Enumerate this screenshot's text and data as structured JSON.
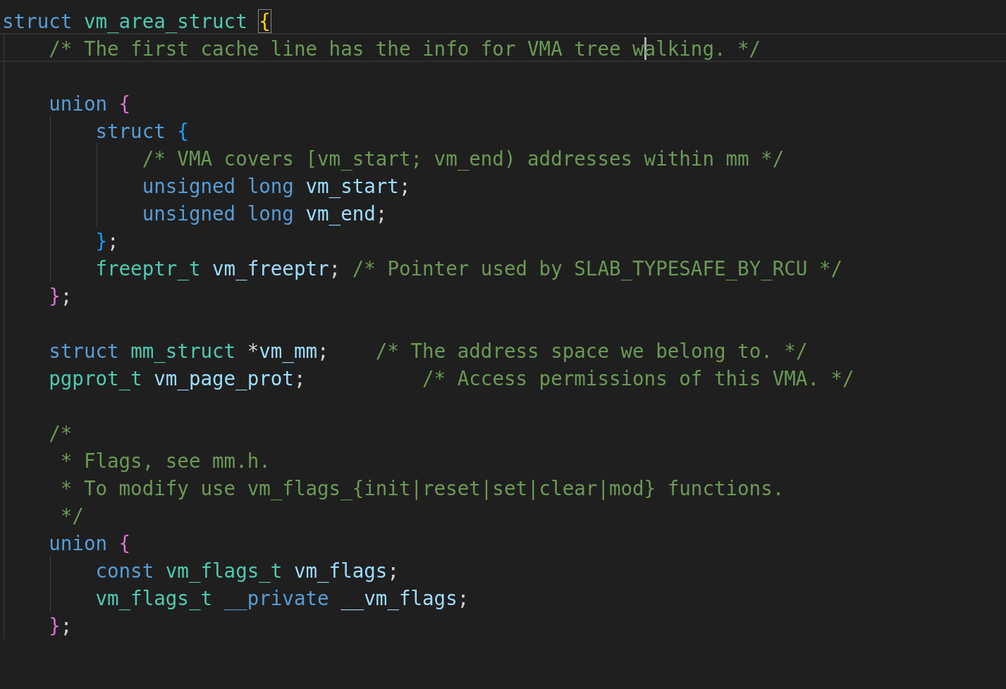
{
  "lines": [
    {
      "kind": "code",
      "tokens": [
        {
          "text": "struct ",
          "kind": "keyword"
        },
        {
          "text": "vm_area_struct ",
          "kind": "type"
        },
        {
          "text": "{",
          "kind": "brace1",
          "matched": true
        }
      ]
    },
    {
      "kind": "code",
      "current": true,
      "tokens": [
        {
          "text": "    /* The first cache line has the info for VMA tree w",
          "kind": "comment"
        },
        {
          "text": "alking. */",
          "kind": "comment",
          "cursor": true
        }
      ]
    },
    {
      "kind": "blank"
    },
    {
      "kind": "code",
      "tokens": [
        {
          "text": "    union ",
          "kind": "keyword"
        },
        {
          "text": "{",
          "kind": "brace2"
        }
      ]
    },
    {
      "kind": "code",
      "tokens": [
        {
          "text": "        struct ",
          "kind": "keyword"
        },
        {
          "text": "{",
          "kind": "brace3"
        }
      ]
    },
    {
      "kind": "code",
      "tokens": [
        {
          "text": "            /* VMA covers [vm_start; vm_end) addresses within mm */",
          "kind": "comment"
        }
      ]
    },
    {
      "kind": "code",
      "tokens": [
        {
          "text": "            unsigned long ",
          "kind": "keyword"
        },
        {
          "text": "vm_start",
          "kind": "variable"
        },
        {
          "text": ";",
          "kind": "plain"
        }
      ]
    },
    {
      "kind": "code",
      "tokens": [
        {
          "text": "            unsigned long ",
          "kind": "keyword"
        },
        {
          "text": "vm_end",
          "kind": "variable"
        },
        {
          "text": ";",
          "kind": "plain"
        }
      ]
    },
    {
      "kind": "code",
      "tokens": [
        {
          "text": "        }",
          "kind": "brace3"
        },
        {
          "text": ";",
          "kind": "plain"
        }
      ]
    },
    {
      "kind": "code",
      "tokens": [
        {
          "text": "        freeptr_t ",
          "kind": "type"
        },
        {
          "text": "vm_freeptr",
          "kind": "variable"
        },
        {
          "text": "; ",
          "kind": "plain"
        },
        {
          "text": "/* Pointer used by SLAB_TYPESAFE_BY_RCU */",
          "kind": "comment"
        }
      ]
    },
    {
      "kind": "code",
      "tokens": [
        {
          "text": "    }",
          "kind": "brace2"
        },
        {
          "text": ";",
          "kind": "plain"
        }
      ]
    },
    {
      "kind": "blank"
    },
    {
      "kind": "code",
      "tokens": [
        {
          "text": "    struct ",
          "kind": "keyword"
        },
        {
          "text": "mm_struct ",
          "kind": "type"
        },
        {
          "text": "*",
          "kind": "plain"
        },
        {
          "text": "vm_mm",
          "kind": "variable"
        },
        {
          "text": ";    ",
          "kind": "plain"
        },
        {
          "text": "/* The address space we belong to. */",
          "kind": "comment"
        }
      ]
    },
    {
      "kind": "code",
      "tokens": [
        {
          "text": "    pgprot_t ",
          "kind": "type"
        },
        {
          "text": "vm_page_prot",
          "kind": "variable"
        },
        {
          "text": ";          ",
          "kind": "plain"
        },
        {
          "text": "/* Access permissions of this VMA. */",
          "kind": "comment"
        }
      ]
    },
    {
      "kind": "blank"
    },
    {
      "kind": "code",
      "tokens": [
        {
          "text": "    /*",
          "kind": "comment"
        }
      ]
    },
    {
      "kind": "code",
      "tokens": [
        {
          "text": "     * Flags, see mm.h.",
          "kind": "comment"
        }
      ]
    },
    {
      "kind": "code",
      "tokens": [
        {
          "text": "     * To modify use vm_flags_{init|reset|set|clear|mod} functions.",
          "kind": "comment"
        }
      ]
    },
    {
      "kind": "code",
      "tokens": [
        {
          "text": "     */",
          "kind": "comment"
        }
      ]
    },
    {
      "kind": "code",
      "tokens": [
        {
          "text": "    union ",
          "kind": "keyword"
        },
        {
          "text": "{",
          "kind": "brace2"
        }
      ]
    },
    {
      "kind": "code",
      "tokens": [
        {
          "text": "        const ",
          "kind": "keyword"
        },
        {
          "text": "vm_flags_t ",
          "kind": "type"
        },
        {
          "text": "vm_flags",
          "kind": "variable"
        },
        {
          "text": ";",
          "kind": "plain"
        }
      ]
    },
    {
      "kind": "code",
      "tokens": [
        {
          "text": "        vm_flags_t ",
          "kind": "type"
        },
        {
          "text": "__private ",
          "kind": "keyword"
        },
        {
          "text": "__vm_flags",
          "kind": "variable"
        },
        {
          "text": ";",
          "kind": "plain"
        }
      ]
    },
    {
      "kind": "code",
      "tokens": [
        {
          "text": "    }",
          "kind": "brace2"
        },
        {
          "text": ";",
          "kind": "plain"
        }
      ]
    }
  ]
}
